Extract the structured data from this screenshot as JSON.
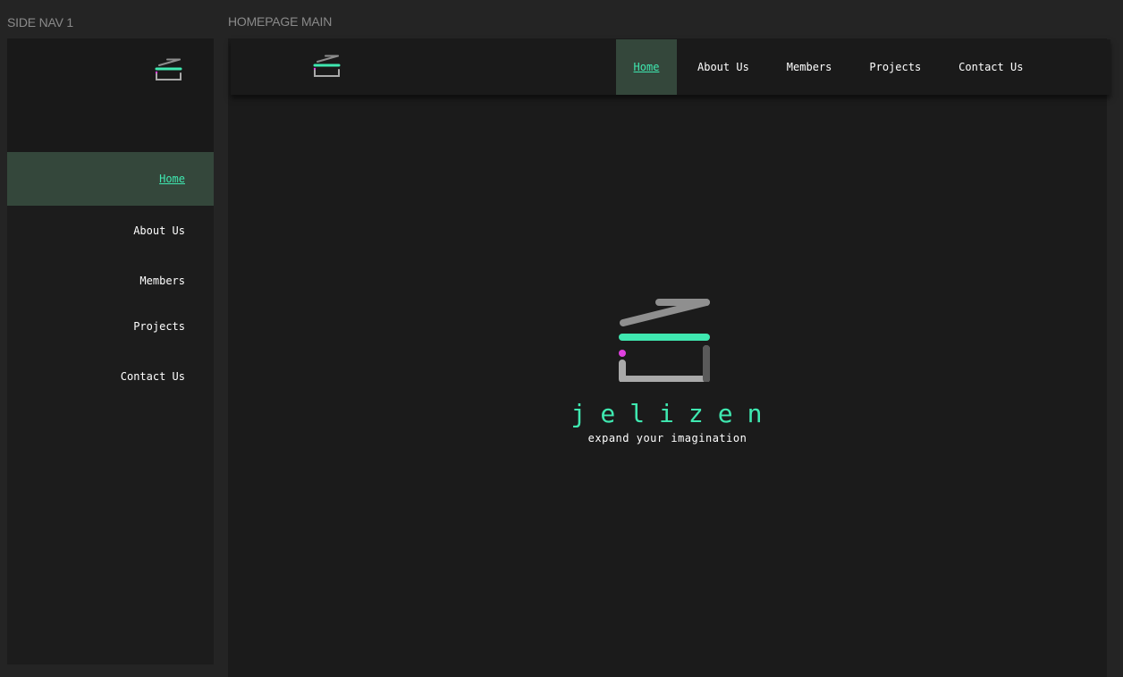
{
  "frames": {
    "side_nav_label": "SIDE NAV 1",
    "main_label": "HOMEPAGE MAIN"
  },
  "side_nav": {
    "logo_icon": "jelizen-logo-icon",
    "items": [
      {
        "label": "Home",
        "active": true
      },
      {
        "label": "About Us",
        "active": false
      },
      {
        "label": "Members",
        "active": false
      },
      {
        "label": "Projects",
        "active": false
      },
      {
        "label": "Contact Us",
        "active": false
      }
    ]
  },
  "top_nav": {
    "logo_icon": "jelizen-logo-icon",
    "items": [
      {
        "label": "Home",
        "active": true
      },
      {
        "label": "About Us",
        "active": false
      },
      {
        "label": "Members",
        "active": false
      },
      {
        "label": "Projects",
        "active": false
      },
      {
        "label": "Contact Us",
        "active": false
      }
    ]
  },
  "hero": {
    "logo_icon": "jelizen-logo-icon",
    "title": "jelizen",
    "tagline": "expand your imagination"
  },
  "colors": {
    "background": "#242424",
    "panel": "#1b1b1b",
    "accent": "#3fe8b0",
    "active_bg": "#34473b",
    "logo_grey": "#a9a9a9",
    "logo_dot": "#e040e0"
  }
}
